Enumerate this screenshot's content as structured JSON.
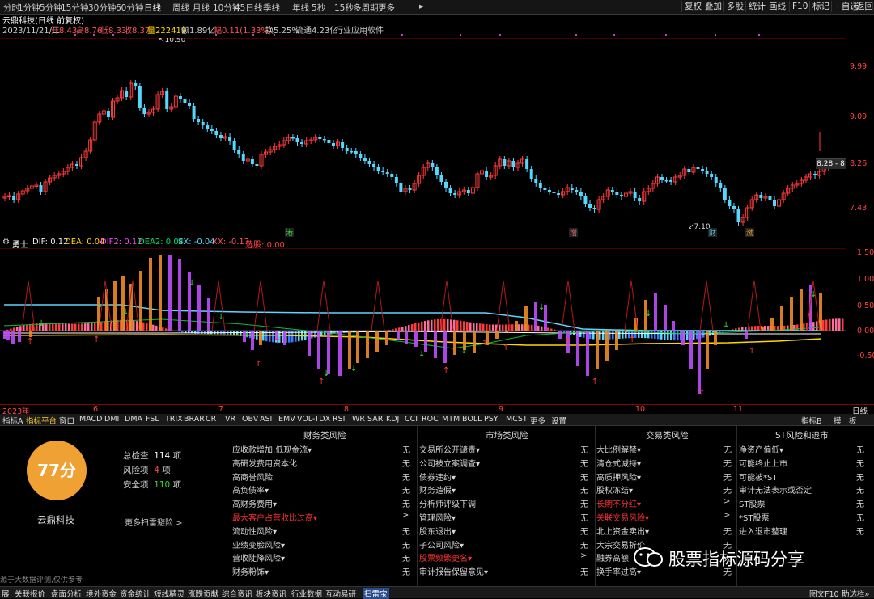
{
  "toolbar": {
    "timeframes": [
      "分时",
      "1分钟",
      "5分钟",
      "15分钟",
      "30分钟",
      "60分钟",
      "日线",
      "周线",
      "月线",
      "10分钟",
      "45日线",
      "季线",
      "年线",
      "5秒",
      "15秒",
      "多周期",
      "更多"
    ],
    "active_timeframe": "日线",
    "more_arrow": "▸",
    "right_buttons": [
      "复权",
      "叠加",
      "多股",
      "统计",
      "画线",
      "F10",
      "标记",
      "+自选",
      "返回"
    ]
  },
  "stock": {
    "title": "云鼎科技(日线 前复权)",
    "date": "2023/11/21/二",
    "open_label": "开",
    "open": "8.43",
    "high_label": "高",
    "high": "8.76",
    "low_label": "低",
    "low": "8.33",
    "close_label": "收",
    "close": "8.37",
    "volume_label": "量",
    "volume": "222419",
    "amount_label": "额",
    "amount": "1.89亿",
    "change_label": "幅",
    "change": "0.11(1.33%)",
    "turnover_label": "换",
    "turnover": "5.25%",
    "float_label": "流通",
    "float_cap": "4.23亿",
    "industry": "行业应用软件"
  },
  "price_axis": [
    "9.99",
    "9.09",
    "8.26",
    "7.43"
  ],
  "price_marks": {
    "high": "10.50",
    "low": "7.10",
    "last": "8.28 - 8"
  },
  "event_markers": [
    "港",
    "增",
    "财",
    "渤"
  ],
  "indicator": {
    "name": "勇士",
    "dif_label": "DIF:",
    "dif": "0.12",
    "dea_label": "DEA:",
    "dea": "0.04",
    "dif2_label": "DIF2:",
    "dif2": "0.12",
    "dea2_label": "DEA2:",
    "dea2": "0.04",
    "sx_label": "SX:",
    "sx": "-0.04",
    "xx_label": "XX:",
    "xx": "-0.17",
    "tail": "选股:",
    "tail_val": "0.00"
  },
  "indicator_axis": [
    "1.50",
    "1.00",
    "0.50",
    "0.00",
    "-0.50"
  ],
  "dates": [
    "2023年",
    "6",
    "7",
    "8",
    "9",
    "10",
    "11"
  ],
  "date_right": "日线",
  "tabs": [
    "指标A",
    "指标平台",
    "窗口",
    "MACD",
    "DMI",
    "DMA",
    "FSL",
    "TRIX",
    "BRAR",
    "CR",
    "VR",
    "OBV",
    "ASI",
    "EMV",
    "VOL-TDX",
    "RSI",
    "WR",
    "SAR",
    "KDJ",
    "CCI",
    "ROC",
    "MTM",
    "BOLL",
    "PSY",
    "MCST",
    "更多",
    "设置"
  ],
  "active_tab": "指标平台",
  "tabs_right": [
    "指标B",
    "模",
    "板"
  ],
  "risk": {
    "score": "77分",
    "company": "云鼎科技",
    "total_label": "总检查",
    "total": "114",
    "total_unit": "项",
    "risk_label": "风险项",
    "risk_count": "4",
    "risk_unit": "项",
    "safe_label": "安全项",
    "safe": "110",
    "safe_unit": "项",
    "more_link": "更多扫雷避险 >",
    "footer_note": "源于大数据评测,仅供参考",
    "columns": [
      {
        "title": "财务类风险",
        "items": [
          {
            "label": "应收款增加,低现金流▾",
            "value": "无",
            "red": false
          },
          {
            "label": "高研发费用资本化",
            "value": "无",
            "red": false
          },
          {
            "label": "高商誉风险",
            "value": "无",
            "red": false
          },
          {
            "label": "高负债率▾",
            "value": "无",
            "red": false
          },
          {
            "label": "高财务费用▾",
            "value": "无",
            "red": false
          },
          {
            "label": "最大客户占营收比过高▾",
            "value": ">",
            "red": true
          },
          {
            "label": "流动性风险▾",
            "value": "无",
            "red": false
          },
          {
            "label": "业绩变脸风险▾",
            "value": "无",
            "red": false
          },
          {
            "label": "营收陡降风险▾",
            "value": "无",
            "red": false
          },
          {
            "label": "财务粉饰▾",
            "value": "无",
            "red": false
          }
        ]
      },
      {
        "title": "市场类风险",
        "items": [
          {
            "label": "交易所公开谴责▾",
            "value": "无",
            "red": false
          },
          {
            "label": "公司被立案调查▾",
            "value": "无",
            "red": false
          },
          {
            "label": "债券违约▾",
            "value": "无",
            "red": false
          },
          {
            "label": "财务造假▾",
            "value": "无",
            "red": false
          },
          {
            "label": "分析师评级下调",
            "value": "无",
            "red": false
          },
          {
            "label": "管理风险▾",
            "value": "无",
            "red": false
          },
          {
            "label": "股东退出▾",
            "value": "无",
            "red": false
          },
          {
            "label": "子公司风险▾",
            "value": "无",
            "red": false
          },
          {
            "label": "股票频繁更名▾",
            "value": ">",
            "red": true
          },
          {
            "label": "审计报告保留意见▾",
            "value": "无",
            "red": false
          }
        ]
      },
      {
        "title": "交易类风险",
        "items": [
          {
            "label": "大比例解禁▾",
            "value": "无",
            "red": false
          },
          {
            "label": "清仓式减持▾",
            "value": "无",
            "red": false
          },
          {
            "label": "高质押风险▾",
            "value": "无",
            "red": false
          },
          {
            "label": "股权冻结▾",
            "value": "无",
            "red": false
          },
          {
            "label": "长期不分红▾",
            "value": ">",
            "red": true
          },
          {
            "label": "关联交易风险▾",
            "value": ">",
            "red": true
          },
          {
            "label": "北上资金卖出▾",
            "value": "无",
            "red": false
          },
          {
            "label": "大宗交易折价",
            "value": "无",
            "red": false
          },
          {
            "label": "融券高额",
            "value": "无",
            "red": false
          },
          {
            "label": "换手率过高▾",
            "value": "无",
            "red": false
          }
        ]
      },
      {
        "title": "ST风险和退市",
        "items": [
          {
            "label": "净资产偏低▾",
            "value": "无",
            "red": false
          },
          {
            "label": "可能终止上市",
            "value": "无",
            "red": false
          },
          {
            "label": "可能被*ST",
            "value": "无",
            "red": false
          },
          {
            "label": "审计无法表示或否定",
            "value": "无",
            "red": false
          },
          {
            "label": "ST股票",
            "value": "无",
            "red": false
          },
          {
            "label": "*ST股票",
            "value": "无",
            "red": false
          },
          {
            "label": "进入退市整理",
            "value": "无",
            "red": false
          }
        ]
      }
    ]
  },
  "watermark": "股票指标源码分享",
  "bottom_tabs": [
    "展",
    "关联报价",
    "盘面分析",
    "境外资金",
    "资金统计",
    "短线精灵",
    "涨跌贡献",
    "综合资讯",
    "板块资讯",
    "行业数据",
    "互动易研",
    "扫雷宝"
  ],
  "bottom_active": "扫雷宝",
  "bottom_right": [
    "图文F10",
    "助达栏»"
  ],
  "colors": {
    "up": "#ff3b3b",
    "down": "#54d8ff",
    "ma_white": "#ffffff",
    "ma_yellow": "#ffd700",
    "cyan_line": "#5fd5ff",
    "purple": "#c04bff",
    "orange": "#f08a24",
    "score": "#f0a133"
  }
}
